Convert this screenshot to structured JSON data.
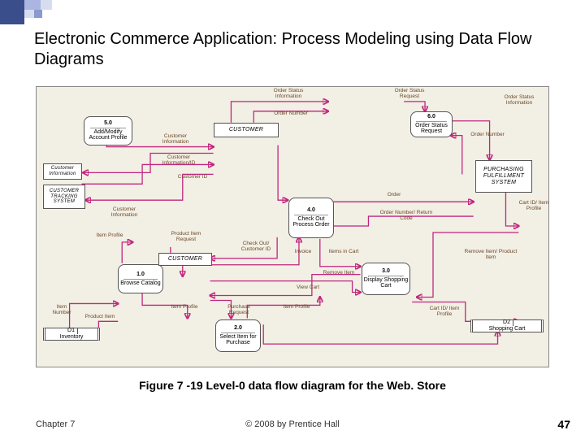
{
  "title": "Electronic Commerce Application: Process Modeling using Data Flow Diagrams",
  "caption": "Figure 7 -19 Level-0 data flow diagram for the Web. Store",
  "footer": {
    "left": "Chapter 7",
    "center": "© 2008 by Prentice Hall",
    "right": "47"
  },
  "processes": {
    "p1": {
      "num": "1.0",
      "name": "Browse Catalog"
    },
    "p2": {
      "num": "2.0",
      "name": "Select Item for Purchase"
    },
    "p3": {
      "num": "3.0",
      "name": "Display Shopping Cart"
    },
    "p4": {
      "num": "4.0",
      "name": "Check Out Process Order"
    },
    "p5": {
      "num": "5.0",
      "name": "Add/Modify Account Profile"
    },
    "p6": {
      "num": "6.0",
      "name": "Order Status Request"
    }
  },
  "externals": {
    "cust_top": "CUSTOMER",
    "cust_mid": "CUSTOMER",
    "cts": "CUSTOMER TRACKING SYSTEM",
    "pfs": "PURCHASING FULFILLMENT SYSTEM"
  },
  "stores": {
    "d1": {
      "id": "D1",
      "name": "Inventory"
    },
    "d2": {
      "id": "D2",
      "name": "Shopping Cart"
    }
  },
  "flows": {
    "osi1": "Order Status Information",
    "onum1": "Order Number",
    "osr": "Order Status Request",
    "osi2": "Order Status Information",
    "onum2": "Order Number",
    "custinfo1": "Customer Information",
    "custinfoid": "Customer Information/ID",
    "custinfo2": "Customer Information",
    "custid": "Customer ID",
    "custinfo3": "Customer Information",
    "order": "Order",
    "onrc": "Order Number/ Return Code",
    "cartidip": "Cart ID/ Item Profile",
    "ccid": "Check Out/ Customer ID",
    "invoice": "Invoice",
    "iic": "Items in Cart",
    "ri": "Remove Item",
    "rip": "Remove Item/ Product Item",
    "vc": "View Cart",
    "cartidip2": "Cart ID/ Item Profile",
    "ip": "Item Profile",
    "pir": "Product Item Request",
    "ip2": "Item Profile",
    "pr": "Purchase Request",
    "ipr": "Item Profile",
    "inum": "Item Number",
    "pi": "Product Item"
  }
}
